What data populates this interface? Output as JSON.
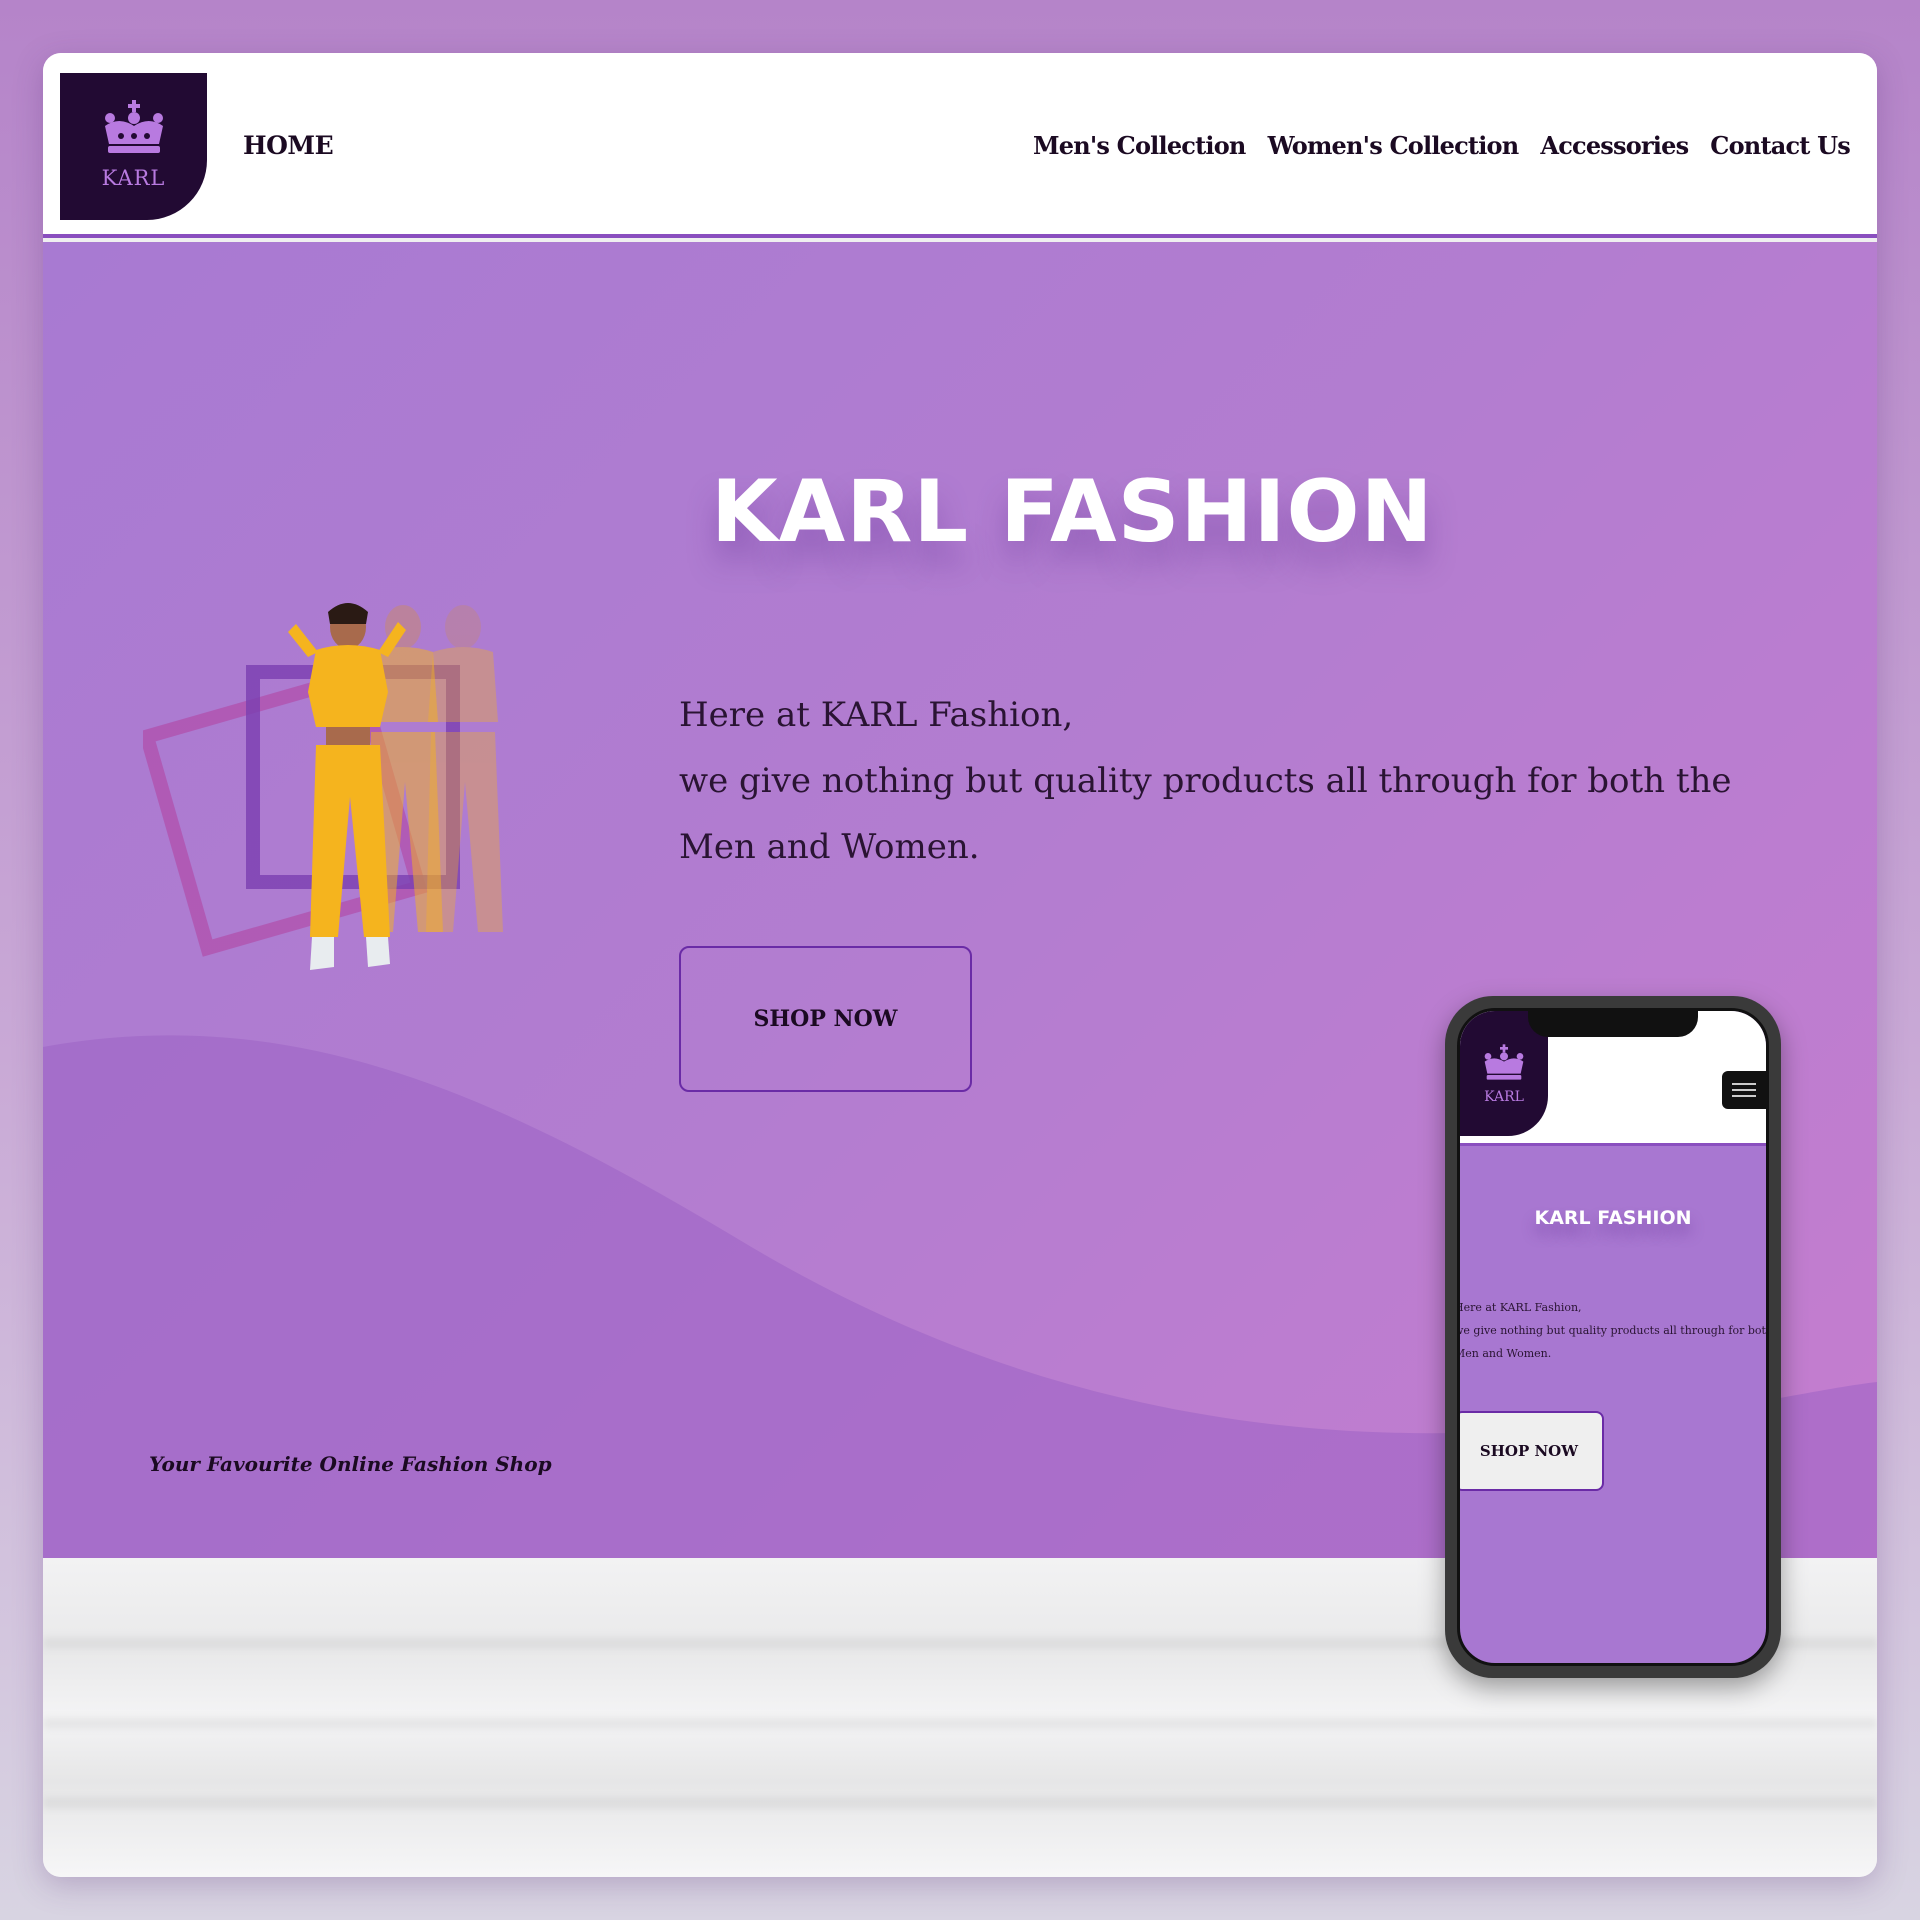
{
  "colors": {
    "accent": "#8a4fbf",
    "logo_bg": "#220a33",
    "logo_text": "#b87ae0",
    "hero_start": "#a87ad2",
    "hero_end": "#c57dcf",
    "model_outfit": "#f5b41e"
  },
  "logo": {
    "text": "KARL",
    "icon": "crown-icon"
  },
  "nav": {
    "home": "HOME",
    "links": [
      "Men's Collection",
      "Women's Collection",
      "Accessories",
      "Contact Us"
    ]
  },
  "hero": {
    "title": "KARL FASHION",
    "line1": "Here at KARL Fashion,",
    "line2": "we give nothing but quality products all through for both the Men and Women.",
    "button": "SHOP NOW",
    "tagline": "Your Favourite Online Fashion Shop"
  },
  "phone": {
    "logo_text": "KARL",
    "menu_icon": "hamburger-icon",
    "title": "KARL FASHION",
    "line1": "Here at KARL Fashion,",
    "line2": "we give nothing but quality products all through for both",
    "line3": "Men and Women.",
    "button": "SHOP NOW"
  }
}
